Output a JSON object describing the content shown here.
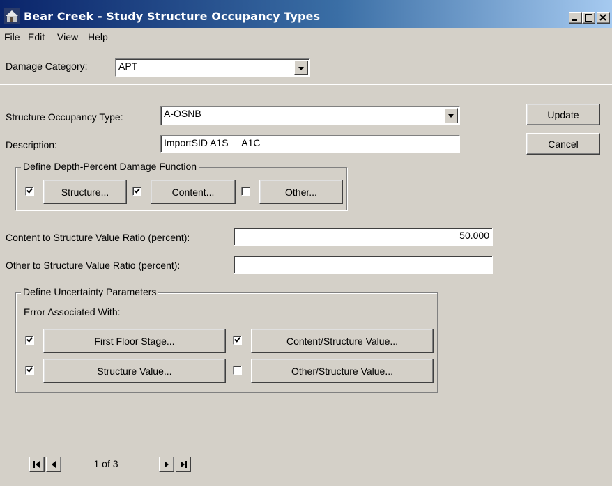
{
  "window": {
    "title": "Bear Creek - Study Structure Occupancy Types",
    "controls": [
      "minimize-icon",
      "maximize-icon",
      "close-icon"
    ]
  },
  "menu": [
    {
      "label": "File"
    },
    {
      "label": "Edit"
    },
    {
      "label": "View"
    },
    {
      "label": "Help"
    }
  ],
  "damage_category": {
    "label": "Damage Category:",
    "value": "APT"
  },
  "occupancy": {
    "type_label": "Structure Occupancy Type:",
    "type_value": "A-OSNB",
    "description_label": "Description:",
    "description_value": "ImportSID A1S     A1C"
  },
  "actions": {
    "update": "Update",
    "cancel": "Cancel"
  },
  "depth_damage": {
    "title": "Define Depth-Percent Damage Function",
    "items": [
      {
        "label": "Structure...",
        "checked": true
      },
      {
        "label": "Content...",
        "checked": true
      },
      {
        "label": "Other...",
        "checked": false
      }
    ]
  },
  "ratios": {
    "content_label": "Content to Structure Value Ratio (percent):",
    "content_value": "50.000",
    "other_label": "Other to Structure Value Ratio (percent):",
    "other_value": ""
  },
  "uncertainty": {
    "title": "Define Uncertainty Parameters",
    "error_label": "Error Associated With:",
    "items": [
      {
        "label": "First Floor Stage...",
        "checked": true
      },
      {
        "label": "Content/Structure Value...",
        "checked": true
      },
      {
        "label": "Structure Value...",
        "checked": true
      },
      {
        "label": "Other/Structure Value...",
        "checked": false
      }
    ]
  },
  "navigator": {
    "record": "1 of 3",
    "buttons": [
      "first-record-icon",
      "prev-record-icon",
      "next-record-icon",
      "last-record-icon"
    ]
  }
}
